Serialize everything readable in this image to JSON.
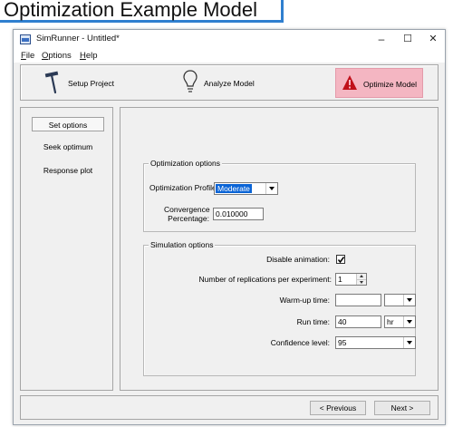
{
  "slide": {
    "title": "Optimization Example Model"
  },
  "window": {
    "title": "SimRunner - Untitled*",
    "minimize": "–",
    "maximize": "☐",
    "close": "✕"
  },
  "menu": [
    "File",
    "Options",
    "Help"
  ],
  "toolbar": {
    "setup_project": "Setup Project",
    "analyze_model": "Analyze Model",
    "optimize_model": "Optimize Model",
    "active_color": "#f4b6c2"
  },
  "sidebar": {
    "items": [
      "Set options",
      "Seek optimum",
      "Response plot"
    ],
    "selected": 0
  },
  "optimization": {
    "group_title": "Optimization options",
    "profile_label": "Optimization Profile:",
    "profile_value": "Moderate",
    "convergence_label_1": "Convergence",
    "convergence_label_2": "Percentage:",
    "convergence_value": "0.010000"
  },
  "simulation": {
    "group_title": "Simulation options",
    "disable_animation_label": "Disable animation:",
    "disable_animation_checked": true,
    "replications_label": "Number of replications per experiment:",
    "replications_value": "1",
    "warmup_label": "Warm-up time:",
    "warmup_value": "",
    "warmup_unit": "",
    "runtime_label": "Run time:",
    "runtime_value": "40",
    "runtime_unit": "hr",
    "confidence_label": "Confidence level:",
    "confidence_value": "95"
  },
  "footer": {
    "previous": "< Previous",
    "next": "Next >"
  },
  "colors": {
    "accent_border": "#2f7fcf",
    "selection": "#0a64d6",
    "alert_icon": "#c0101a"
  }
}
